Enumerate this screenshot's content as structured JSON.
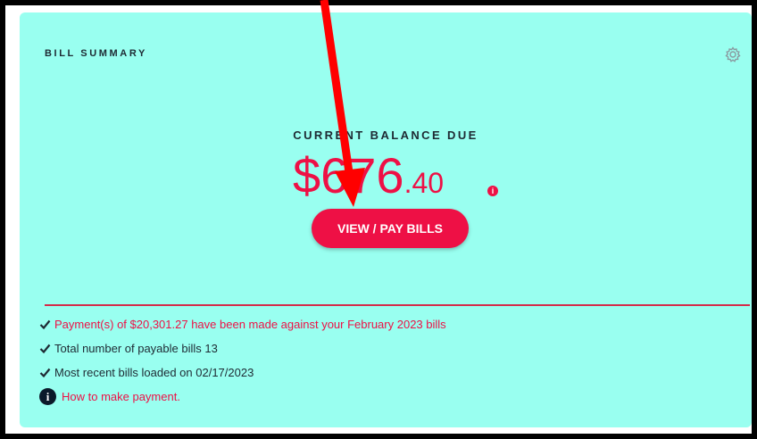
{
  "card": {
    "title": "BILL SUMMARY",
    "settings_icon": "gear-icon"
  },
  "balance": {
    "label": "CURRENT BALANCE DUE",
    "dollars": "$676",
    "cents": ".40",
    "info_icon": "info-icon",
    "info_glyph": "i"
  },
  "pay_button": {
    "label": "VIEW / PAY BILLS"
  },
  "info_lines": [
    {
      "text": "Payment(s) of $20,301.27 have been made against your February 2023 bills",
      "icon": "check-icon"
    },
    {
      "text": "Total number of payable bills 13",
      "icon": "check-icon"
    },
    {
      "text": "Most recent bills loaded on 02/17/2023",
      "icon": "check-icon"
    }
  ],
  "help": {
    "text": "How to make payment.",
    "icon": "info-circle-icon",
    "glyph": "i"
  },
  "annotation": {
    "color": "#ff0000"
  },
  "colors": {
    "card_bg": "#99fff0",
    "accent": "#ee1045",
    "text": "#1e2a33"
  }
}
